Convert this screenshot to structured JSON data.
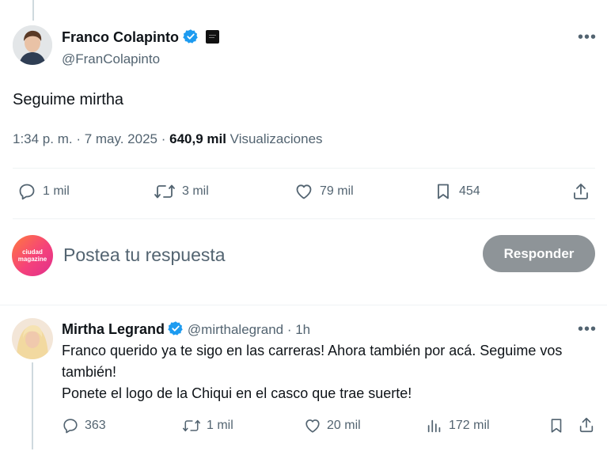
{
  "tweet": {
    "author_name": "Franco Colapinto",
    "author_handle": "@FranColapinto",
    "text": "Seguime mirtha",
    "time": "1:34 p. m. · 7 may. 2025 · ",
    "views_count": "640,9 mil",
    "views_label": " Visualizaciones",
    "stats": {
      "replies": "1 mil",
      "reposts": "3 mil",
      "likes": "79 mil",
      "bookmarks": "454"
    }
  },
  "composer": {
    "avatar_text_line1": "ciudad",
    "avatar_text_line2": "magazine",
    "placeholder": "Postea tu respuesta",
    "button_label": "Responder"
  },
  "reply": {
    "author_name": "Mirtha Legrand",
    "author_handle": "@mirthalegrand",
    "time": " · 1h",
    "line1": "Franco querido ya te sigo en las carreras! Ahora también por acá. Seguime vos",
    "line2": "también!",
    "line3": "Ponete el logo de la Chiqui en el casco que trae suerte!",
    "stats": {
      "replies": "363",
      "reposts": "1 mil",
      "likes": "20 mil",
      "views": "172 mil"
    }
  },
  "colors": {
    "verified": "#1d9bf0",
    "text_primary": "#0f1419",
    "text_secondary": "#536471",
    "button_disabled": "#8e9498"
  }
}
